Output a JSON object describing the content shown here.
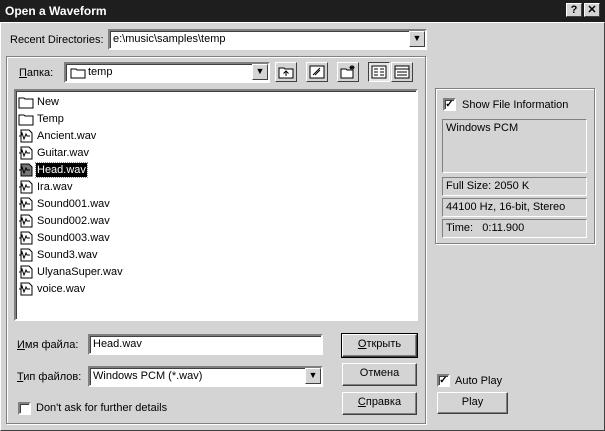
{
  "window": {
    "title": "Open a Waveform",
    "help_button": "?",
    "close_button": "✕"
  },
  "recent": {
    "label": "Recent Directories:",
    "value": "e:\\music\\samples\\temp"
  },
  "folder": {
    "label": "Папка:",
    "label_accel": "П",
    "label_rest": "апка:",
    "value": "temp"
  },
  "files": [
    {
      "name": "New",
      "type": "folder"
    },
    {
      "name": "Temp",
      "type": "folder"
    },
    {
      "name": "Ancient.wav",
      "type": "wav"
    },
    {
      "name": "Guitar.wav",
      "type": "wav"
    },
    {
      "name": "Head.wav",
      "type": "wav",
      "selected": true
    },
    {
      "name": "Ira.wav",
      "type": "wav"
    },
    {
      "name": "Sound001.wav",
      "type": "wav"
    },
    {
      "name": "Sound002.wav",
      "type": "wav"
    },
    {
      "name": "Sound003.wav",
      "type": "wav"
    },
    {
      "name": "Sound3.wav",
      "type": "wav"
    },
    {
      "name": "UlyanaSuper.wav",
      "type": "wav"
    },
    {
      "name": "voice.wav",
      "type": "wav"
    }
  ],
  "filename": {
    "label": "Имя файла:",
    "label_accel": "И",
    "label_rest": "мя файла:",
    "value": "Head.wav"
  },
  "filetype": {
    "label": "Тип файлов:",
    "label_accel": "Т",
    "label_rest": "ип файлов:",
    "value": "Windows PCM (*.wav)"
  },
  "buttons": {
    "open": "Открыть",
    "open_accel": "О",
    "open_rest": "ткрыть",
    "cancel": "Отмена",
    "help": "Справка",
    "help_accel": "С",
    "help_rest": "правка"
  },
  "dont_ask": {
    "label": "Don't ask for further details",
    "checked": false
  },
  "info": {
    "show_label": "Show File Information",
    "show_checked": true,
    "format": "Windows PCM",
    "full_size": "Full Size: 2050 K",
    "details": "44100 Hz, 16-bit, Stereo",
    "time_label": "Time:",
    "time_value": "0:11.900"
  },
  "autoplay": {
    "label": "Auto Play",
    "checked": true
  },
  "play_button": "Play",
  "icons": [
    "folder-icon",
    "up-folder-icon",
    "desktop-icon",
    "new-folder-icon",
    "list-view-icon",
    "details-view-icon",
    "wave-file-icon"
  ]
}
